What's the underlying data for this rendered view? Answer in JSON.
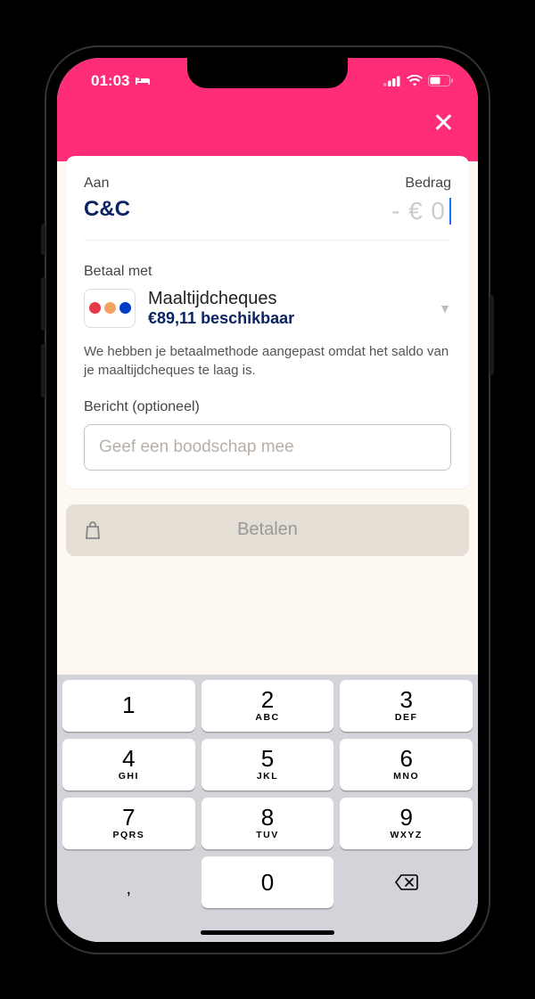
{
  "status": {
    "time": "01:03"
  },
  "form": {
    "to_label": "Aan",
    "to_value": "C&C",
    "amount_label": "Bedrag",
    "amount_value": "- € 0",
    "pay_with_label": "Betaal met",
    "method_name": "Maaltijdcheques",
    "method_available": "€89,11 beschikbaar",
    "warning": "We hebben je betaalmethode aangepast omdat het saldo van je maaltijdcheques te laag is.",
    "message_label": "Bericht (optioneel)",
    "message_placeholder": "Geef een boodschap mee",
    "pay_button": "Betalen"
  },
  "keypad": {
    "keys": [
      [
        {
          "n": "1",
          "s": ""
        },
        {
          "n": "2",
          "s": "ABC"
        },
        {
          "n": "3",
          "s": "DEF"
        }
      ],
      [
        {
          "n": "4",
          "s": "GHI"
        },
        {
          "n": "5",
          "s": "JKL"
        },
        {
          "n": "6",
          "s": "MNO"
        }
      ],
      [
        {
          "n": "7",
          "s": "PQRS"
        },
        {
          "n": "8",
          "s": "TUV"
        },
        {
          "n": "9",
          "s": "WXYZ"
        }
      ]
    ],
    "comma": ",",
    "zero": "0"
  }
}
